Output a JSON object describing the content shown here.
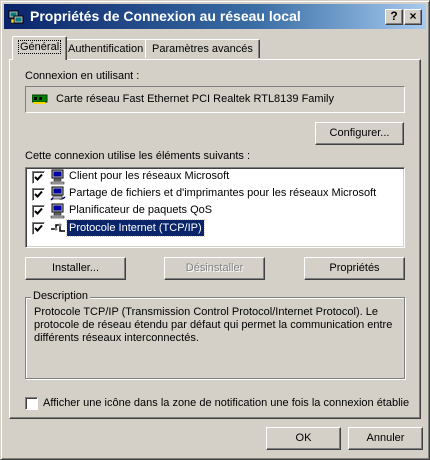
{
  "window": {
    "title": "Propriétés de Connexion au réseau local",
    "help_button": "?",
    "close_button": "×"
  },
  "tabs": [
    {
      "label": "Général",
      "active": true
    },
    {
      "label": "Authentification",
      "active": false
    },
    {
      "label": "Paramètres avancés",
      "active": false
    }
  ],
  "connection": {
    "label": "Connexion en utilisant :",
    "adapter": "Carte réseau Fast Ethernet PCI Realtek RTL8139 Family",
    "configure_button": "Configurer..."
  },
  "components": {
    "label": "Cette connexion utilise les éléments suivants :",
    "items": [
      {
        "label": "Client pour les réseaux Microsoft",
        "checked": true,
        "icon": "network-client-icon"
      },
      {
        "label": "Partage de fichiers et d'imprimantes pour les réseaux Microsoft",
        "checked": true,
        "icon": "file-printer-sharing-icon"
      },
      {
        "label": "Planificateur de paquets QoS",
        "checked": true,
        "icon": "qos-scheduler-icon"
      },
      {
        "label": "Protocole Internet (TCP/IP)",
        "checked": true,
        "icon": "protocol-icon",
        "selected": true
      }
    ],
    "install_button": "Installer...",
    "uninstall_button": "Désinstaller",
    "properties_button": "Propriétés"
  },
  "description": {
    "title": "Description",
    "text": "Protocole TCP/IP (Transmission Control Protocol/Internet Protocol). Le protocole de réseau étendu par défaut qui permet la communication entre différents réseaux interconnectés."
  },
  "notification": {
    "label": "Afficher une icône dans la zone de notification une fois la connexion établie",
    "checked": false
  },
  "footer": {
    "ok_button": "OK",
    "cancel_button": "Annuler"
  }
}
